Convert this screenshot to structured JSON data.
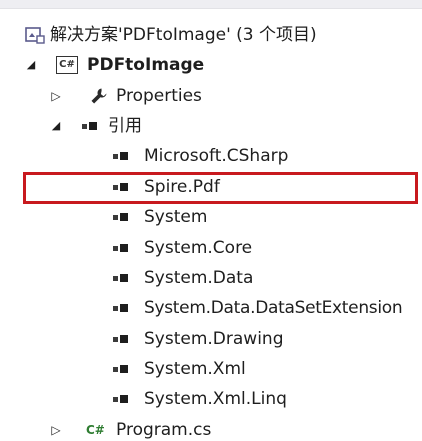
{
  "solution": {
    "label": "解决方案'PDFtoImage' (3 个项目)",
    "icon": "solution-icon"
  },
  "project": {
    "label": "PDFtoImage",
    "icon": "csharp-project-icon",
    "icon_text": "C#"
  },
  "properties": {
    "label": "Properties",
    "icon": "wrench-icon"
  },
  "references_node": {
    "label": "引用",
    "icon": "references-icon"
  },
  "references": [
    "Microsoft.CSharp",
    "Spire.Pdf",
    "System",
    "System.Core",
    "System.Data",
    "System.Data.DataSetExtension",
    "System.Drawing",
    "System.Xml",
    "System.Xml.Linq"
  ],
  "program_file": {
    "label": "Program.cs",
    "icon": "csharp-file-icon",
    "icon_text": "C#"
  },
  "highlighted_reference": "Spire.Pdf",
  "colors": {
    "highlight": "#c8191e",
    "csharp_file": "#2f7d32",
    "solution_icon": "#5a5a8c"
  }
}
